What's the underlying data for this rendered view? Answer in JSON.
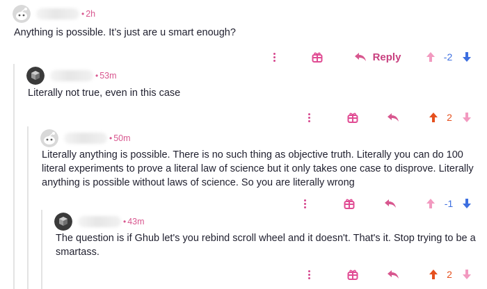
{
  "comments": [
    {
      "time": "2h",
      "text": "Anything is possible. It’s just are u smart enough?",
      "score": "-2",
      "vote": "down",
      "reply_label": "Reply",
      "avatar": "snoo-avatar"
    },
    {
      "time": "53m",
      "text": "Literally not true, even in this case",
      "score": "2",
      "vote": "up",
      "avatar": "dark-cube-avatar"
    },
    {
      "time": "50m",
      "text": "Literally anything is possible. There is no such thing as objective truth. Literally you can do 100 literal experiments to prove a literal law of science but it only takes one case to disprove. Literally anything is possible without laws of science. So you are literally wrong",
      "score": "-1",
      "vote": "down",
      "avatar": "snoo-avatar"
    },
    {
      "time": "43m",
      "text": "The question is if Ghub let's you rebind scroll wheel and it doesn't. That's it. Stop trying to be a smartass.",
      "score": "2",
      "vote": "up",
      "avatar": "dark-cube-avatar"
    }
  ],
  "separator": "•",
  "colors": {
    "accent": "#d8578f",
    "upvote_active": "#e5501e",
    "downvote": "#3d6fe0",
    "upvote_idle": "#f29ac0"
  },
  "icons": [
    "more-options-icon",
    "award-icon",
    "reply-arrow-icon",
    "upvote-arrow-icon",
    "downvote-arrow-icon"
  ]
}
